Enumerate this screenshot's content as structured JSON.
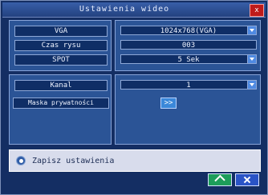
{
  "window": {
    "title": "Ustawienia wideo",
    "close_label": "x"
  },
  "settings": {
    "rows": [
      {
        "label": "VGA",
        "value": "1024x768(VGA)"
      },
      {
        "label": "Czas rysu",
        "value": "003"
      },
      {
        "label": "SPOT",
        "value": "5 Sek"
      }
    ],
    "channel": {
      "label": "Kanal",
      "value": "1"
    },
    "privacy_mask": {
      "label": "Maska prywatności",
      "button_label": ">>"
    }
  },
  "status": {
    "message": "Zapisz ustawienia"
  },
  "icons": {
    "close": "close-icon",
    "dropdown": "chevron-down-icon",
    "save_status": "info-icon",
    "confirm": "check-icon",
    "cancel": "x-icon"
  },
  "colors": {
    "window_bg": "#142e63",
    "panel_bg": "#2b5496",
    "field_bg": "#0f2e66",
    "accent_green": "#1d9d5a",
    "accent_blue": "#2a54c6",
    "close_red": "#be1a1a"
  }
}
